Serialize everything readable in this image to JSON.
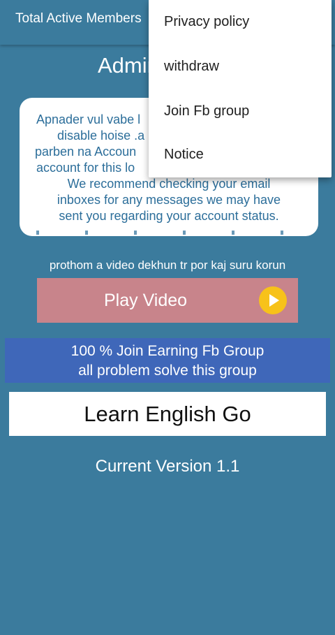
{
  "topbar": {
    "title": "Total Active Members"
  },
  "admin_title": "Admin",
  "notice": {
    "lines": [
      "Apnader vul vabe l",
      "disable hoise .a",
      "parben na Accoun",
      "account for this lo",
      "We recommend checking your email",
      "inboxes for any messages we may have",
      "sent you regarding your account status."
    ]
  },
  "instruction": "prothom a video dekhun tr por kaj suru korun",
  "play_video": {
    "label": "Play Video",
    "icon": "play-circle-icon",
    "color": "#c8848b",
    "icon_color": "#f7c21a"
  },
  "fb_group": {
    "line1": "100 % Join Earning Fb Group",
    "line2": "all problem solve this group",
    "color": "#3f67b9"
  },
  "learn_english": {
    "label": "Learn English Go"
  },
  "version": "Current Version 1.1",
  "menu": {
    "items": [
      {
        "label": "Privacy policy"
      },
      {
        "label": "withdraw"
      },
      {
        "label": "Join Fb group"
      },
      {
        "label": "Notice"
      }
    ]
  },
  "colors": {
    "background": "#3b7b9d",
    "notice_text": "#2c6e9a"
  }
}
